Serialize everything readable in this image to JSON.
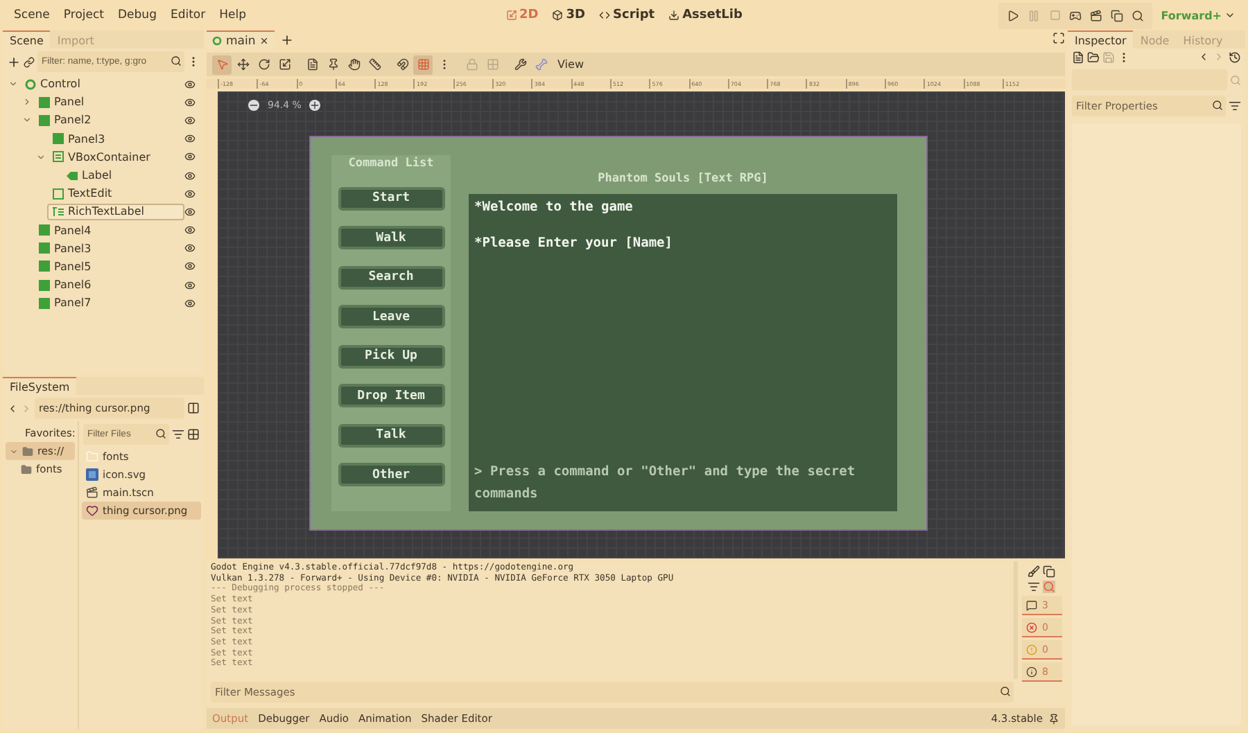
{
  "menu": [
    "Scene",
    "Project",
    "Debug",
    "Editor",
    "Help"
  ],
  "workspaces": [
    {
      "label": "2D",
      "selected": true,
      "kind": "twod"
    },
    {
      "label": "3D",
      "selected": false,
      "kind": "threed"
    },
    {
      "label": "Script",
      "selected": false,
      "kind": "script"
    },
    {
      "label": "AssetLib",
      "selected": false,
      "kind": "assetlib"
    }
  ],
  "renderer": "Forward+",
  "scene_dock": {
    "tabs": [
      {
        "label": "Scene",
        "selected": true
      },
      {
        "label": "Import",
        "selected": false
      }
    ],
    "filter_placeholder": "Filter: name, t:type, g:gro",
    "tree": [
      {
        "name": "Control",
        "kind": "control",
        "expanded": true,
        "selected": false,
        "children": [
          {
            "name": "Panel",
            "kind": "panel",
            "expanded": false,
            "selected": false
          },
          {
            "name": "Panel2",
            "kind": "panel",
            "expanded": true,
            "selected": false,
            "children": [
              {
                "name": "Panel3",
                "kind": "panel",
                "selected": false
              },
              {
                "name": "VBoxContainer",
                "kind": "vbox",
                "expanded": true,
                "selected": false,
                "children": [
                  {
                    "name": "Label",
                    "kind": "label",
                    "selected": false
                  }
                ]
              },
              {
                "name": "TextEdit",
                "kind": "textedit",
                "selected": false
              },
              {
                "name": "RichTextLabel",
                "kind": "richtext",
                "selected": true
              }
            ]
          },
          {
            "name": "Panel4",
            "kind": "panel",
            "selected": false
          },
          {
            "name": "Panel3",
            "kind": "panel",
            "selected": false
          },
          {
            "name": "Panel5",
            "kind": "panel",
            "selected": false
          },
          {
            "name": "Panel6",
            "kind": "panel",
            "selected": false
          },
          {
            "name": "Panel7",
            "kind": "panel",
            "selected": false
          }
        ]
      }
    ]
  },
  "filesystem": {
    "title": "FileSystem",
    "path": "res://thing cursor.png",
    "favorites": "Favorites:",
    "tree": [
      {
        "name": "res://",
        "selected": true,
        "expanded": true,
        "children": [
          {
            "name": "fonts",
            "selected": false
          }
        ]
      }
    ],
    "filter_placeholder": "Filter Files",
    "files": [
      {
        "name": "fonts",
        "kind": "folder",
        "selected": false
      },
      {
        "name": "icon.svg",
        "kind": "svg",
        "selected": false
      },
      {
        "name": "main.tscn",
        "kind": "scene",
        "selected": false
      },
      {
        "name": "thing cursor.png",
        "kind": "image",
        "selected": true
      }
    ]
  },
  "editor_tabs": [
    {
      "label": "main",
      "selected": true
    }
  ],
  "toolbar": {
    "view_menu": "View"
  },
  "ruler": [
    "-128",
    "-64",
    "0",
    "64",
    "128",
    "192",
    "256",
    "320",
    "384",
    "448",
    "512",
    "576",
    "640",
    "704",
    "768",
    "832",
    "896",
    "960",
    "1024",
    "1088",
    "1152"
  ],
  "zoom": "94.4 %",
  "game": {
    "command_title": "Command List",
    "commands": [
      "Start",
      "Walk",
      "Search",
      "Leave",
      "Pick Up",
      "Drop Item",
      "Talk",
      "Other"
    ],
    "heading": "Phantom Souls [Text RPG]",
    "lines": [
      "*Welcome to the game",
      "*Please Enter your [Name]"
    ],
    "prompt": "> Press a command or \"Other\" and type the secret commands"
  },
  "output": {
    "lines": [
      {
        "text": "Godot Engine v4.3.stable.official.77dcf97d8 - https://godotengine.org",
        "kind": "normal"
      },
      {
        "text": "Vulkan 1.3.278 - Forward+ - Using Device #0: NVIDIA - NVIDIA GeForce RTX 3050 Laptop GPU",
        "kind": "normal"
      },
      {
        "text": "--- Debugging process stopped ---",
        "kind": "dim"
      },
      {
        "text": "Set text",
        "kind": "dim"
      },
      {
        "text": "Set text",
        "kind": "dim"
      },
      {
        "text": "Set text",
        "kind": "dim"
      },
      {
        "text": "Set text",
        "kind": "dim"
      },
      {
        "text": "Set text",
        "kind": "dim"
      },
      {
        "text": "Set text",
        "kind": "dim"
      },
      {
        "text": "Set text",
        "kind": "dim"
      }
    ],
    "filter_placeholder": "Filter Messages",
    "counters": [
      {
        "kind": "message",
        "count": "3"
      },
      {
        "kind": "error",
        "count": "0"
      },
      {
        "kind": "warning",
        "count": "0"
      },
      {
        "kind": "info",
        "count": "8"
      }
    ]
  },
  "bottom_tabs": [
    {
      "label": "Output",
      "selected": true
    },
    {
      "label": "Debugger",
      "selected": false
    },
    {
      "label": "Audio",
      "selected": false
    },
    {
      "label": "Animation",
      "selected": false
    },
    {
      "label": "Shader Editor",
      "selected": false
    }
  ],
  "version": "4.3.stable",
  "inspector": {
    "tabs": [
      {
        "label": "Inspector",
        "selected": true
      },
      {
        "label": "Node",
        "selected": false
      },
      {
        "label": "History",
        "selected": false
      }
    ],
    "filter_placeholder": "Filter Properties"
  }
}
